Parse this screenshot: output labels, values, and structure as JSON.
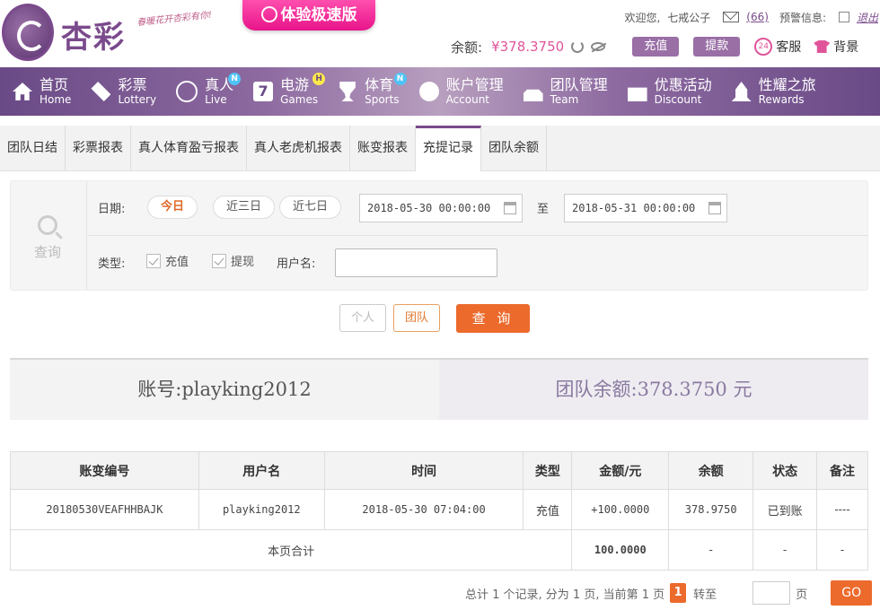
{
  "header": {
    "logo_text": "杏彩",
    "slogan": "春暖花开杏彩有你!",
    "fast_badge": "体验极速版",
    "welcome": "欢迎您,",
    "username": "七戒公子",
    "mail_count": "(66)",
    "warning": "预警信息:",
    "logout": "退出",
    "balance_label": "余额:",
    "balance_value": "¥378.3750",
    "recharge": "充值",
    "withdraw": "提款",
    "service_icon_text": "24",
    "service": "客服",
    "skin": "背景"
  },
  "nav": [
    {
      "cn": "首页",
      "en": "Home",
      "badge": ""
    },
    {
      "cn": "彩票",
      "en": "Lottery",
      "badge": ""
    },
    {
      "cn": "真人",
      "en": "Live",
      "badge": "N"
    },
    {
      "cn": "电游",
      "en": "Games",
      "badge": "H",
      "icon_text": "7"
    },
    {
      "cn": "体育",
      "en": "Sports",
      "badge": "N"
    },
    {
      "cn": "账户管理",
      "en": "Account",
      "badge": ""
    },
    {
      "cn": "团队管理",
      "en": "Team",
      "badge": ""
    },
    {
      "cn": "优惠活动",
      "en": "Discount",
      "badge": ""
    },
    {
      "cn": "性耀之旅",
      "en": "Rewards",
      "badge": ""
    }
  ],
  "tabs": [
    "团队日结",
    "彩票报表",
    "真人体育盈亏报表",
    "真人老虎机报表",
    "账变报表",
    "充提记录",
    "团队余额"
  ],
  "query": {
    "search_label": "查询",
    "date_label": "日期:",
    "quick_ranges": [
      "今日",
      "近三日",
      "近七日"
    ],
    "start_date": "2018-05-30 00:00:00",
    "to": "至",
    "end_date": "2018-05-31 00:00:00",
    "type_label": "类型:",
    "type_options": [
      "充值",
      "提现"
    ],
    "username_label": "用户名:",
    "username_value": "",
    "scope_personal": "个人",
    "scope_team": "团队",
    "submit": "查 询"
  },
  "summary": {
    "account": "账号:playking2012",
    "team_balance": "团队余额:378.3750 元"
  },
  "table": {
    "headers": [
      "账变编号",
      "用户名",
      "时间",
      "类型",
      "金额/元",
      "余额",
      "状态",
      "备注"
    ],
    "rows": [
      [
        "20180530VEAFHHBAJK",
        "playking2012",
        "2018-05-30 07:04:00",
        "充值",
        "+100.0000",
        "378.9750",
        "已到账",
        "----"
      ]
    ],
    "footer": {
      "label": "本页合计",
      "amount": "100.0000",
      "balance": "-",
      "status": "-",
      "note": "-"
    }
  },
  "pager": {
    "summary": "总计 1 个记录, 分为 1 页, 当前第 1 页",
    "current": "1",
    "goto": "转至",
    "page_unit": "页",
    "go": "GO"
  },
  "colors": {
    "brand": "#7a4a8c",
    "accent": "#ec6a2c",
    "positive": "#5a9a1a"
  }
}
